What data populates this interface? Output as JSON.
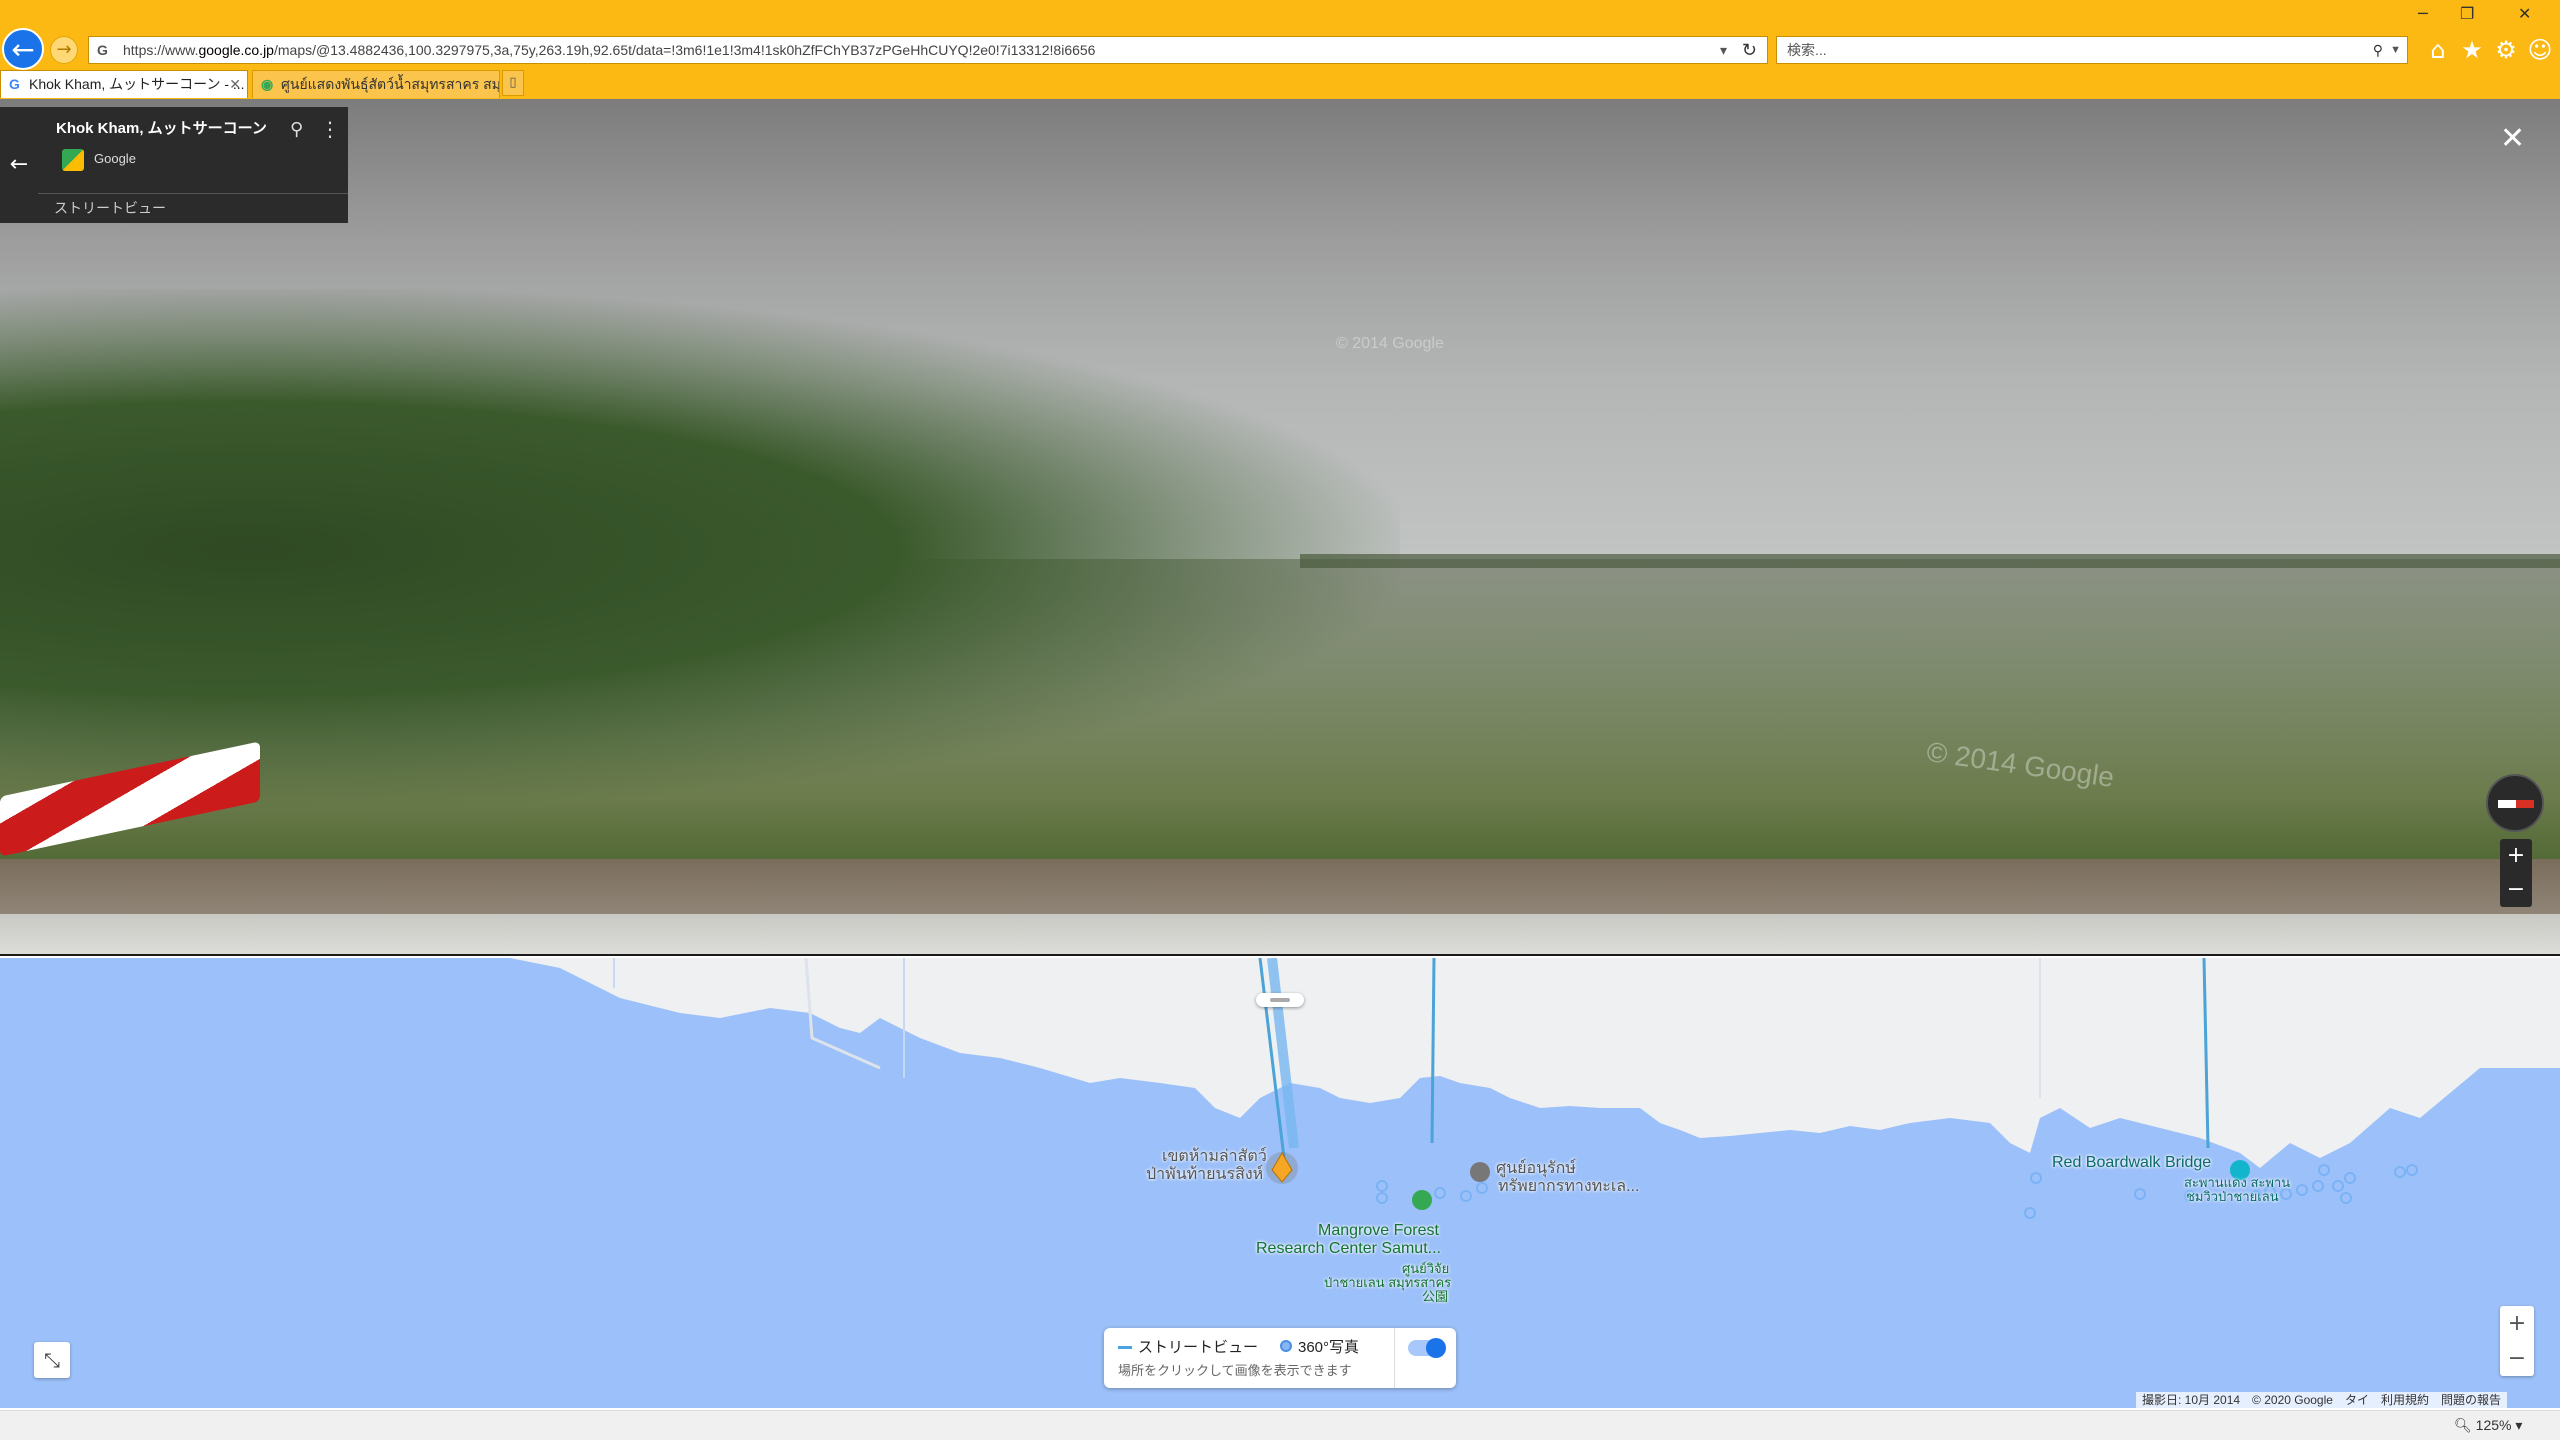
{
  "browser": {
    "url_prefix": "https://www.",
    "url_domain": "google.co.jp",
    "url_rest": "/maps/@13.4882436,100.3297975,3a,75y,263.19h,92.65t/data=!3m6!1e1!3m4!1sk0hZfFChYB37zPGeHhCUYQ!2e0!7i13312!8i6656",
    "search_placeholder": "検索...",
    "tabs": [
      {
        "label": "Khok Kham, ムットサーコーン - ...",
        "active": true
      },
      {
        "label": "ศูนย์แสดงพันธุ์สัตว์น้ำสมุทรสาคร สมุ...",
        "active": false
      }
    ],
    "zoom_level": "125%"
  },
  "streetview": {
    "place_name": "Khok Kham, ムットサーコーン",
    "provider": "Google",
    "mode_label": "ストリートビュー",
    "watermarks": [
      "© 2014 Google",
      "© 2014 Google"
    ]
  },
  "map": {
    "labels": {
      "thai_sanctuary_1": "เขตห้ามล่าสัตว์",
      "thai_sanctuary_2": "ป่าพันท้ายนรสิงห์",
      "mangrove_1": "Mangrove Forest",
      "mangrove_2": "Research Center Samut...",
      "mangrove_th_1": "ศูนย์วิจัย",
      "mangrove_th_2": "ป่าชายเลน สมุทรสาคร",
      "mangrove_th_3": "公園",
      "conservation_1": "ศูนย์อนุรักษ์",
      "conservation_2": "ทรัพยากรทางทะเล...",
      "boardwalk": "Red Boardwalk Bridge",
      "boardwalk_th_1": "สะพานแดง สะพาน",
      "boardwalk_th_2": "ชมวิวป่าชายเลน"
    },
    "legend": {
      "streetview": "ストリートビュー",
      "photo360": "360°写真",
      "hint": "場所をクリックして画像を表示できます"
    },
    "attribution": {
      "captured": "撮影日: 10月 2014",
      "copyright": "© 2020 Google",
      "country": "タイ",
      "terms": "利用規約",
      "report": "問題の報告"
    }
  }
}
